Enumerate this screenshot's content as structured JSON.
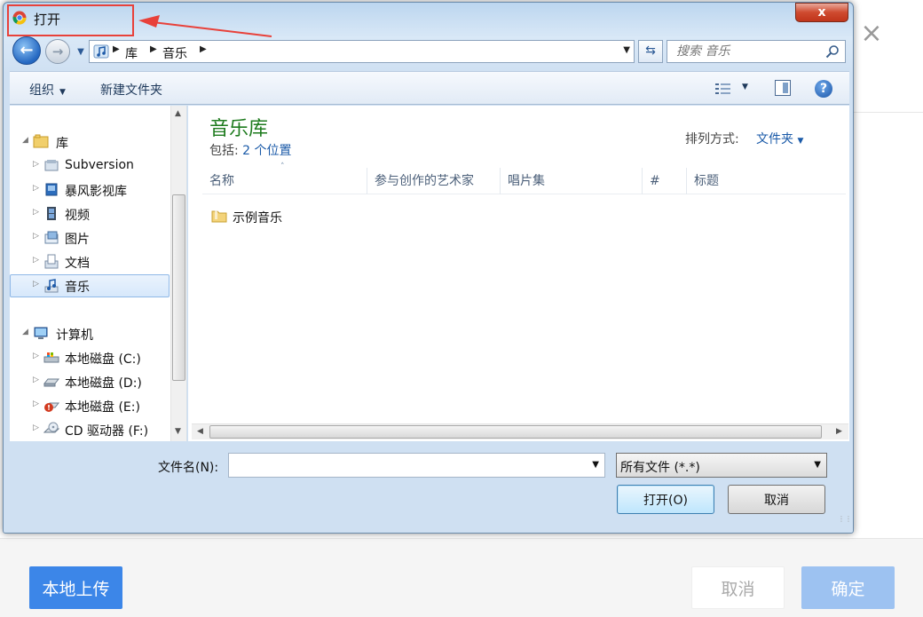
{
  "background": {
    "close_glyph": "×",
    "upload_label": "本地上传",
    "cancel_label": "取消",
    "ok_label": "确定"
  },
  "dialog": {
    "title": "打开",
    "close_glyph": "x",
    "address": {
      "segments": [
        "库",
        "音乐"
      ]
    },
    "search": {
      "placeholder": "搜索 音乐"
    },
    "toolbar": {
      "organize_label": "组织",
      "new_folder_label": "新建文件夹"
    },
    "nav_tree": {
      "library_label": "库",
      "library_items": [
        "Subversion",
        "暴风影视库",
        "视频",
        "图片",
        "文档",
        "音乐"
      ],
      "computer_label": "计算机",
      "drives": [
        "本地磁盘 (C:)",
        "本地磁盘 (D:)",
        "本地磁盘 (E:)",
        "CD 驱动器 (F:)"
      ]
    },
    "content": {
      "library_title": "音乐库",
      "includes_prefix": "包括:",
      "includes_link": "2 个位置",
      "sort_label": "排列方式:",
      "sort_value": "文件夹",
      "columns": [
        "名称",
        "参与创作的艺术家",
        "唱片集",
        "#",
        "标题"
      ],
      "files": [
        "示例音乐"
      ]
    },
    "bottom": {
      "filename_label": "文件名(N):",
      "filename_value": "",
      "filetype_value": "所有文件 (*.*)",
      "open_label": "打开(O)",
      "cancel_label": "取消"
    }
  },
  "colors": {
    "accent_blue": "#3c86e8",
    "library_green": "#1e7b1e",
    "annotation_red": "#e8413a"
  }
}
